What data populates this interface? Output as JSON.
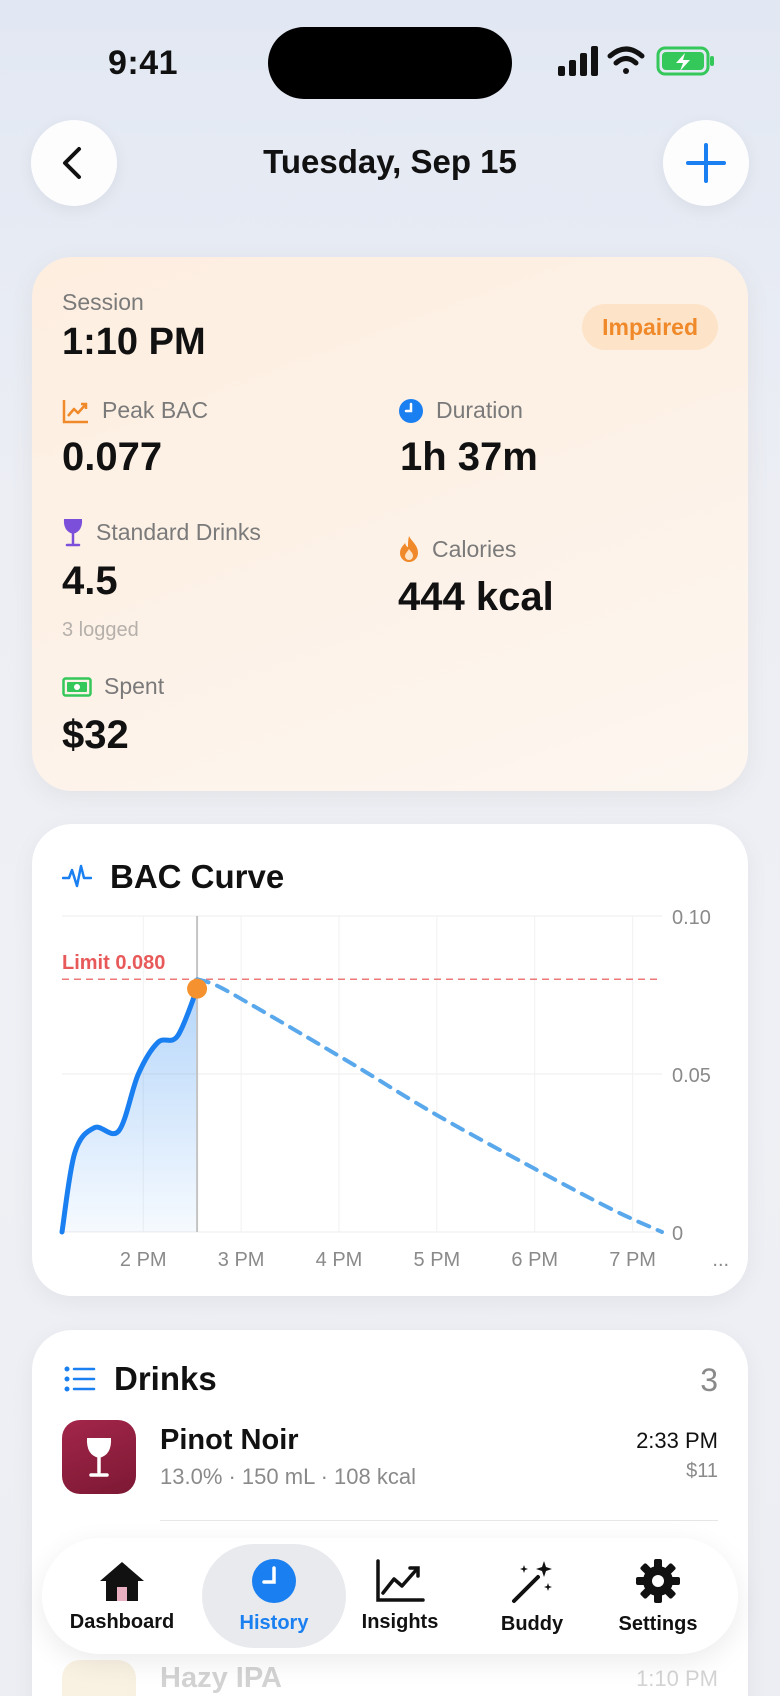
{
  "status_bar": {
    "time": "9:41"
  },
  "header": {
    "title": "Tuesday, Sep 15"
  },
  "session": {
    "label": "Session",
    "time": "1:10 PM",
    "badge": "Impaired",
    "peak_bac": {
      "label": "Peak BAC",
      "value": "0.077"
    },
    "duration": {
      "label": "Duration",
      "value": "1h 37m"
    },
    "standard_drinks": {
      "label": "Standard Drinks",
      "value": "4.5",
      "sub": "3 logged"
    },
    "calories": {
      "label": "Calories",
      "value": "444 kcal"
    },
    "spent": {
      "label": "Spent",
      "value": "$32"
    }
  },
  "chart_data": {
    "type": "line",
    "title": "BAC Curve",
    "limit_label": "Limit 0.080",
    "limit": 0.08,
    "ylim": [
      0,
      0.1
    ],
    "y_ticks": [
      "0.10",
      "0.05",
      "0"
    ],
    "x_ticks": [
      "2 PM",
      "3 PM",
      "4 PM",
      "5 PM",
      "6 PM",
      "7 PM",
      "..."
    ],
    "series": [
      {
        "style": "solid",
        "points": [
          [
            13.17,
            0.0
          ],
          [
            13.3,
            0.025
          ],
          [
            13.5,
            0.033
          ],
          [
            13.75,
            0.032
          ],
          [
            13.95,
            0.05
          ],
          [
            14.15,
            0.06
          ],
          [
            14.35,
            0.062
          ],
          [
            14.55,
            0.077
          ]
        ]
      },
      {
        "style": "dashed",
        "points": [
          [
            14.55,
            0.08
          ],
          [
            14.75,
            0.078
          ],
          [
            15.1,
            0.072
          ],
          [
            15.6,
            0.063
          ],
          [
            16.2,
            0.052
          ],
          [
            17.0,
            0.037
          ],
          [
            18.0,
            0.02
          ],
          [
            18.8,
            0.007
          ],
          [
            19.3,
            0.0
          ]
        ]
      }
    ],
    "peak_marker": [
      14.55,
      0.077
    ]
  },
  "drinks": {
    "title": "Drinks",
    "count": "3",
    "items": [
      {
        "name": "Pinot Noir",
        "details": "13.0% · 150 mL · 108 kcal",
        "time": "2:33 PM",
        "price": "$11"
      },
      {
        "name": "Hazy IPA",
        "time": "1:10 PM"
      }
    ]
  },
  "tabs": [
    {
      "label": "Dashboard",
      "icon": "house-icon"
    },
    {
      "label": "History",
      "icon": "clock-icon",
      "active": true
    },
    {
      "label": "Insights",
      "icon": "chart-icon"
    },
    {
      "label": "Buddy",
      "icon": "sparkles-icon"
    },
    {
      "label": "Settings",
      "icon": "gear-icon"
    }
  ],
  "colors": {
    "accent": "#1a7ff0",
    "orange": "#f0892a",
    "limit": "#e85a5a",
    "wine": "#8c1f3a"
  }
}
